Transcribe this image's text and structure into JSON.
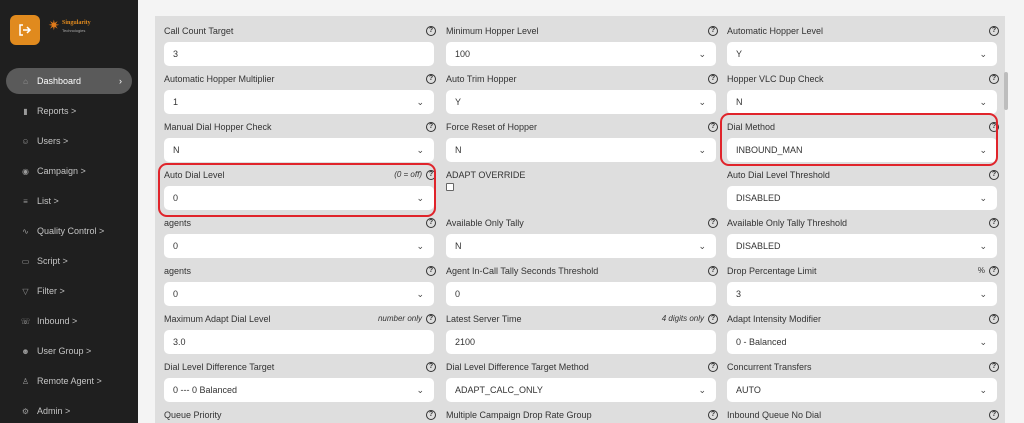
{
  "brand": {
    "name": "Singularity",
    "sub": "Technologies"
  },
  "sidebar": {
    "items": [
      {
        "label": "Dashboard",
        "icon": "home-icon",
        "glyph": "⌂"
      },
      {
        "label": "Reports >",
        "icon": "bar-chart-icon",
        "glyph": "▮"
      },
      {
        "label": "Users >",
        "icon": "users-icon",
        "glyph": "☺"
      },
      {
        "label": "Campaign >",
        "icon": "broadcast-icon",
        "glyph": "◉"
      },
      {
        "label": "List >",
        "icon": "list-icon",
        "glyph": "≡"
      },
      {
        "label": "Quality Control >",
        "icon": "pulse-icon",
        "glyph": "∿"
      },
      {
        "label": "Script >",
        "icon": "document-icon",
        "glyph": "▭"
      },
      {
        "label": "Filter >",
        "icon": "filter-icon",
        "glyph": "▽"
      },
      {
        "label": "Inbound >",
        "icon": "phone-icon",
        "glyph": "☏"
      },
      {
        "label": "User Group >",
        "icon": "user-group-icon",
        "glyph": "☻"
      },
      {
        "label": "Remote Agent >",
        "icon": "remote-agent-icon",
        "glyph": "♙"
      },
      {
        "label": "Admin >",
        "icon": "gear-icon",
        "glyph": "⚙"
      }
    ]
  },
  "form": {
    "fields": [
      {
        "label": "Call Count Target",
        "value": "3",
        "type": "input"
      },
      {
        "label": "Minimum Hopper Level",
        "value": "100",
        "type": "select"
      },
      {
        "label": "Automatic Hopper Level",
        "value": "Y",
        "type": "select"
      },
      {
        "label": "Automatic Hopper Multiplier",
        "value": "1",
        "type": "select"
      },
      {
        "label": "Auto Trim Hopper",
        "value": "Y",
        "type": "select"
      },
      {
        "label": "Hopper VLC Dup Check",
        "value": "N",
        "type": "select"
      },
      {
        "label": "Manual Dial Hopper Check",
        "value": "N",
        "type": "select"
      },
      {
        "label": "Force Reset of Hopper",
        "value": "N",
        "type": "select"
      },
      {
        "label": "Dial Method",
        "value": "INBOUND_MAN",
        "type": "select"
      },
      {
        "label": "Auto Dial Level",
        "note": "(0 = off)",
        "value": "0",
        "type": "select"
      },
      {
        "label": "ADAPT OVERRIDE",
        "type": "checkbox"
      },
      {
        "label": "Auto Dial Level Threshold",
        "value": "DISABLED",
        "type": "select"
      },
      {
        "label": "agents",
        "value": "0",
        "type": "select"
      },
      {
        "label": "Available Only Tally",
        "value": "N",
        "type": "select"
      },
      {
        "label": "Available Only Tally Threshold",
        "value": "DISABLED",
        "type": "select"
      },
      {
        "label": "agents",
        "value": "0",
        "type": "select"
      },
      {
        "label": "Agent In-Call Tally Seconds Threshold",
        "value": "0",
        "type": "input"
      },
      {
        "label": "Drop Percentage Limit",
        "note": "%",
        "value": "3",
        "type": "select"
      },
      {
        "label": "Maximum Adapt Dial Level",
        "note": "number only",
        "value": "3.0",
        "type": "input"
      },
      {
        "label": "Latest Server Time",
        "note": "4 digits only",
        "value": "2100",
        "type": "input"
      },
      {
        "label": "Adapt Intensity Modifier",
        "value": "0 - Balanced",
        "type": "select"
      },
      {
        "label": "Dial Level Difference Target",
        "value": "0 --- 0 Balanced",
        "type": "select"
      },
      {
        "label": "Dial Level Difference Target Method",
        "value": "ADAPT_CALC_ONLY",
        "type": "select"
      },
      {
        "label": "Concurrent Transfers",
        "value": "AUTO",
        "type": "select"
      },
      {
        "label": "Queue Priority",
        "type": "label"
      },
      {
        "label": "Multiple Campaign Drop Rate Group",
        "type": "label"
      },
      {
        "label": "Inbound Queue No Dial",
        "type": "label"
      }
    ]
  },
  "icons": {
    "help": "?",
    "caret": "⌄",
    "chevron": "›"
  },
  "colors": {
    "accent": "#e08a1e",
    "highlight": "#e0242b",
    "sidebar_bg": "#1f1f1f"
  }
}
